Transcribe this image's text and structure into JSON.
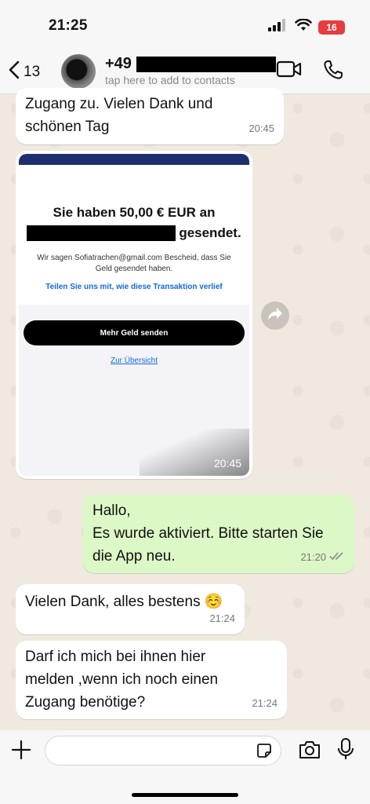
{
  "status": {
    "time": "21:25",
    "battery": "16"
  },
  "header": {
    "back_count": "13",
    "contact_name": "+49",
    "contact_sub": "tap here to add to contacts",
    "icons": [
      "chevron-left-icon",
      "video-call-icon",
      "phone-icon"
    ]
  },
  "messages": [
    {
      "direction": "in",
      "text_lines": [
        "Zugang zu. Vielen Dank und",
        "schönen Tag"
      ],
      "time": "20:45"
    },
    {
      "direction": "in",
      "type": "image",
      "time": "20:45",
      "image": {
        "title_line1": "Sie haben 50,00 € EUR an",
        "title_line2_suffix": "gesendet.",
        "small_text": "Wir sagen Sofiatrachen@gmail.com Bescheid, dass Sie Geld gesendet haben.",
        "link_text": "Teilen Sie uns mit, wie diese Transaktion verlief",
        "button_label": "Mehr Geld senden",
        "overview_link": "Zur Übersicht"
      }
    },
    {
      "direction": "out",
      "text_lines": [
        "Hallo,",
        "Es wurde aktiviert. Bitte starten Sie",
        "die App neu."
      ],
      "time": "21:20",
      "status": "read"
    },
    {
      "direction": "in",
      "text_lines": [
        "Vielen Dank, alles bestens ☺️"
      ],
      "time": "21:24"
    },
    {
      "direction": "in",
      "text_lines": [
        "Darf ich mich bei ihnen hier",
        "melden ,wenn ich noch einen",
        "Zugang benötige?"
      ],
      "time": "21:24"
    }
  ],
  "composer": {
    "placeholder": "",
    "value": ""
  },
  "colors": {
    "incoming": "#ffffff",
    "outgoing": "#dcf8c6",
    "read_ticks": "#8c8c8c",
    "battery": "#e63c3c"
  }
}
